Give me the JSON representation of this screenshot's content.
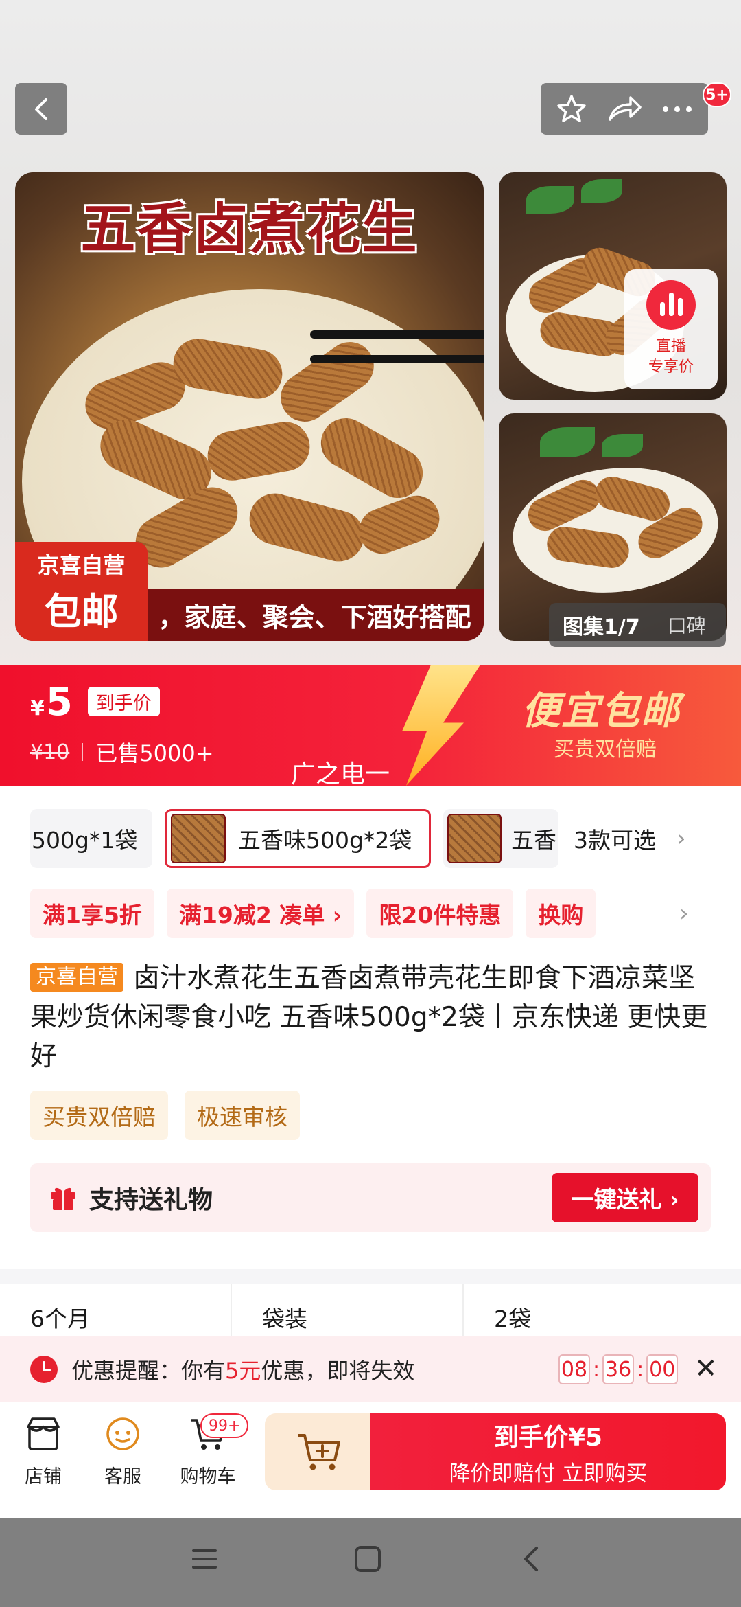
{
  "header": {
    "notification_badge": "5+",
    "icons": [
      "back-icon",
      "star-icon",
      "share-icon",
      "more-icon"
    ]
  },
  "gallery": {
    "photo_title": "五香卤煮花生",
    "photo_banner": "，家庭、聚会、下酒好搭配",
    "photo_stamp_line1": "京喜自营",
    "photo_stamp_line2": "包邮",
    "live_line1": "直播",
    "live_line2": "专享价",
    "gallery_counter": "图集1/7",
    "reviews_tab": "口碑"
  },
  "price": {
    "currency": "¥",
    "value": "5",
    "price_tag": "到手价",
    "original": "¥10",
    "sold": "已售5000+",
    "watermark": "广之电一",
    "promo_title": "便宜包邮",
    "promo_subtitle": "买贵双倍赔"
  },
  "skus": {
    "items": [
      "500g*1袋",
      "五香味500g*2袋",
      "五香味"
    ],
    "more": "3款可选"
  },
  "coupons": [
    "满1享5折",
    "满19减2  凑单 ›",
    "限20件特惠",
    "换购"
  ],
  "product": {
    "self_tag": "京喜自营",
    "title": "卤汁水煮花生五香卤煮带壳花生即食下酒凉菜坚果炒货休闲零食小吃 五香味500g*2袋丨京东快递 更快更好",
    "tags": [
      "买贵双倍赔",
      "极速审核"
    ]
  },
  "gift": {
    "label": "支持送礼物",
    "button": "一键送礼 ›"
  },
  "specs": [
    "6个月",
    "袋装",
    "2袋"
  ],
  "reminder": {
    "prefix": "优惠提醒：你有",
    "amount": "5元",
    "suffix": "优惠，即将失效",
    "timer": [
      "08",
      "36",
      "00"
    ]
  },
  "bottom_bar": {
    "store": "店铺",
    "service": "客服",
    "cart": "购物车",
    "cart_badge": "99+",
    "buy_line1": "到手价¥5",
    "buy_line2": "降价即赔付 立即购买"
  },
  "colors": {
    "accent_red": "#f0102c",
    "promo_gold": "#ffe2a0",
    "self_tag_orange": "#f5891f"
  }
}
